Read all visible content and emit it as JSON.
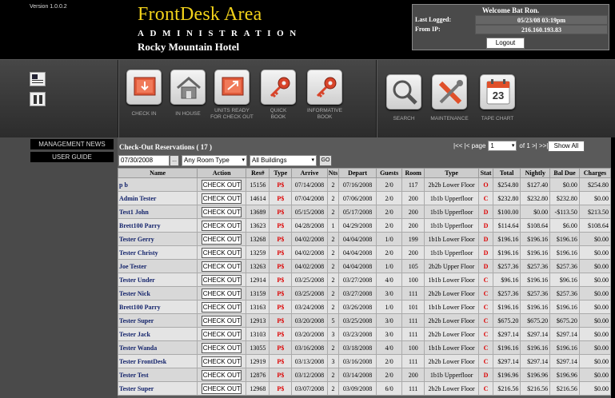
{
  "header": {
    "version": "Version 1.0.0.2",
    "title": "FrontDesk Area",
    "subtitle": "ADMINISTRATION",
    "hotel": "Rocky Mountain Hotel"
  },
  "welcome": {
    "title": "Welcome Bat Ron.",
    "last_logged_label": "Last Logged:",
    "last_logged_value": "05/23/08 03:19pm",
    "from_ip_label": "From IP:",
    "from_ip_value": "216.160.193.83",
    "logout_label": "Logout"
  },
  "toolbar": {
    "tools": [
      {
        "label": "CHECK IN",
        "icon": "check-in-icon"
      },
      {
        "label": "IN HOUSE",
        "icon": "house-icon"
      },
      {
        "label": "UNITS READY FOR CHECK OUT",
        "icon": "check-out-icon"
      },
      {
        "label": "QUICK BOOK",
        "icon": "key-icon"
      },
      {
        "label": "INFORMATIVE BOOK",
        "icon": "key-icon"
      },
      {
        "label": "SEARCH",
        "icon": "search-icon"
      },
      {
        "label": "MAINTENANCE",
        "icon": "wrench-icon"
      },
      {
        "label": "TAPE CHART",
        "icon": "calendar-icon"
      }
    ],
    "calendar_day": "23"
  },
  "leftnav": {
    "items": [
      "MANAGEMENT NEWS",
      "USER GUIDE"
    ]
  },
  "main": {
    "title": "Check-Out Reservations ( 17 )",
    "pager": {
      "prev": "|<< |< page",
      "page": "1",
      "of": "of 1 >| >>|",
      "show_all": "Show All"
    },
    "filters": {
      "date": "07/30/2008",
      "date_btn": "...",
      "room_type": "Any Room Type",
      "buildings": "All Buildings",
      "go": "GO"
    },
    "columns": [
      "Name",
      "Action",
      "Res#",
      "Type",
      "Arrive",
      "Nts",
      "Depart",
      "Guests",
      "Room",
      "Type",
      "Stat",
      "Total",
      "Nightly",
      "Bal Due",
      "Charges"
    ],
    "action_label": "CHECK OUT",
    "rows": [
      [
        "p b",
        "15156",
        "P$",
        "07/14/2008",
        "2",
        "07/16/2008",
        "2/0",
        "117",
        "2b2b Lower Floor",
        "O",
        "$254.80",
        "$127.40",
        "$0.00",
        "$254.80"
      ],
      [
        "Admin Tester",
        "14614",
        "P$",
        "07/04/2008",
        "2",
        "07/06/2008",
        "2/0",
        "200",
        "1b1b Upperfloor",
        "C",
        "$232.80",
        "$232.80",
        "$232.80",
        "$0.00"
      ],
      [
        "Test1 John",
        "13689",
        "P$",
        "05/15/2008",
        "2",
        "05/17/2008",
        "2/0",
        "200",
        "1b1b Upperfloor",
        "D",
        "$100.00",
        "$0.00",
        "-$113.50",
        "$213.50"
      ],
      [
        "Brett100 Parry",
        "13623",
        "P$",
        "04/28/2008",
        "1",
        "04/29/2008",
        "2/0",
        "200",
        "1b1b Upperfloor",
        "D",
        "$114.64",
        "$108.64",
        "$6.00",
        "$108.64"
      ],
      [
        "Tester Gerry",
        "13268",
        "P$",
        "04/02/2008",
        "2",
        "04/04/2008",
        "1/0",
        "199",
        "1b1b Lower Floor",
        "D",
        "$196.16",
        "$196.16",
        "$196.16",
        "$0.00"
      ],
      [
        "Tester Christy",
        "13259",
        "P$",
        "04/02/2008",
        "2",
        "04/04/2008",
        "2/0",
        "200",
        "1b1b Upperfloor",
        "D",
        "$196.16",
        "$196.16",
        "$196.16",
        "$0.00"
      ],
      [
        "Joe  Tester",
        "13263",
        "P$",
        "04/02/2008",
        "2",
        "04/04/2008",
        "1/0",
        "105",
        "2b2b Upper Floor",
        "D",
        "$257.36",
        "$257.36",
        "$257.36",
        "$0.00"
      ],
      [
        "Tester Under",
        "12914",
        "P$",
        "03/25/2008",
        "2",
        "03/27/2008",
        "4/0",
        "100",
        "1b1b Lower Floor",
        "C",
        "$96.16",
        "$196.16",
        "$96.16",
        "$0.00"
      ],
      [
        "Tester Nick",
        "13159",
        "P$",
        "03/25/2008",
        "2",
        "03/27/2008",
        "3/0",
        "111",
        "2b2b Lower Floor",
        "C",
        "$257.36",
        "$257.36",
        "$257.36",
        "$0.00"
      ],
      [
        "Brett100 Parry",
        "13163",
        "P$",
        "03/24/2008",
        "2",
        "03/26/2008",
        "1/0",
        "101",
        "1b1b Lower Floor",
        "C",
        "$196.16",
        "$196.16",
        "$196.16",
        "$0.00"
      ],
      [
        "Tester Super",
        "12913",
        "P$",
        "03/20/2008",
        "5",
        "03/25/2008",
        "3/0",
        "111",
        "2b2b Lower Floor",
        "C",
        "$675.20",
        "$675.20",
        "$675.20",
        "$0.00"
      ],
      [
        "Tester Jack",
        "13103",
        "P$",
        "03/20/2008",
        "3",
        "03/23/2008",
        "3/0",
        "111",
        "2b2b Lower Floor",
        "C",
        "$297.14",
        "$297.14",
        "$297.14",
        "$0.00"
      ],
      [
        "Tester Wanda",
        "13055",
        "P$",
        "03/16/2008",
        "2",
        "03/18/2008",
        "4/0",
        "100",
        "1b1b Lower Floor",
        "C",
        "$196.16",
        "$196.16",
        "$196.16",
        "$0.00"
      ],
      [
        "Tester FrontDesk",
        "12919",
        "P$",
        "03/13/2008",
        "3",
        "03/16/2008",
        "2/0",
        "111",
        "2b2b Lower Floor",
        "C",
        "$297.14",
        "$297.14",
        "$297.14",
        "$0.00"
      ],
      [
        "Tester Test",
        "12876",
        "P$",
        "03/12/2008",
        "2",
        "03/14/2008",
        "2/0",
        "200",
        "1b1b Upperfloor",
        "D",
        "$196.96",
        "$196.96",
        "$196.96",
        "$0.00"
      ],
      [
        "Tester Super",
        "12968",
        "P$",
        "03/07/2008",
        "2",
        "03/09/2008",
        "6/0",
        "111",
        "2b2b Lower Floor",
        "C",
        "$216.56",
        "$216.56",
        "$216.56",
        "$0.00"
      ]
    ]
  }
}
